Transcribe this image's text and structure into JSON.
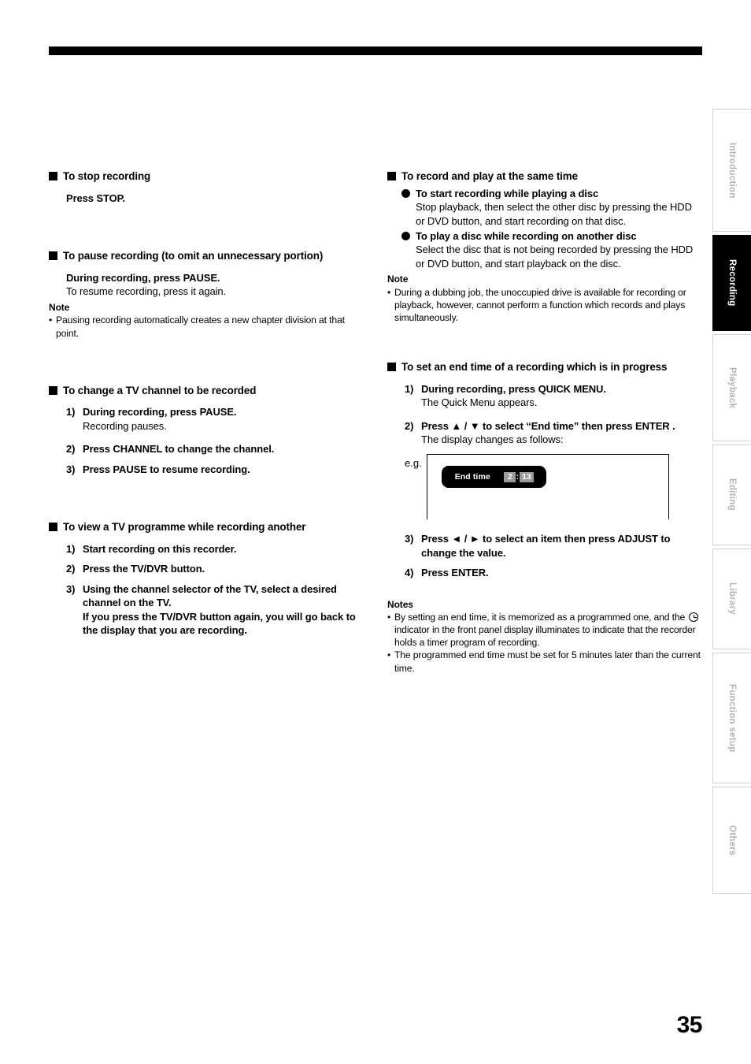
{
  "page": {
    "number": "35",
    "top_rule": true
  },
  "tabs": [
    {
      "label": "Introduction",
      "active": false
    },
    {
      "label": "Recording",
      "active": true
    },
    {
      "label": "Playback",
      "active": false
    },
    {
      "label": "Editing",
      "active": false
    },
    {
      "label": "Library",
      "active": false
    },
    {
      "label": "Function setup",
      "active": false
    },
    {
      "label": "Others",
      "active": false
    }
  ],
  "left_column": {
    "section_stop": {
      "heading": "To stop recording",
      "instruction": "Press STOP."
    },
    "section_pause": {
      "heading": "To pause recording (to omit an unnecessary portion)",
      "instruction": "During recording, press PAUSE.",
      "detail": "To resume recording, press it again.",
      "note_title": "Note",
      "note_items": [
        "Pausing recording automatically creates a new chapter division at that point."
      ]
    },
    "section_change_channel": {
      "heading": "To change a TV channel to be recorded",
      "steps": [
        {
          "num": "1)",
          "text": "During recording, press PAUSE.",
          "sub": "Recording pauses."
        },
        {
          "num": "2)",
          "text": "Press CHANNEL to change the channel.",
          "sub": ""
        },
        {
          "num": "3)",
          "text": "Press PAUSE to resume recording.",
          "sub": ""
        }
      ]
    },
    "section_view_tv": {
      "heading": "To view a TV programme while recording another",
      "steps": [
        {
          "num": "1)",
          "text": "Start recording on this recorder.",
          "sub": ""
        },
        {
          "num": "2)",
          "text": "Press the TV/DVR button.",
          "sub": ""
        },
        {
          "num": "3)",
          "text": "Using the channel selector of the TV, select a desired channel on the TV.",
          "sub": ""
        }
      ],
      "step3_extra": "If you press the TV/DVR button again, you will go back to the display that you are recording."
    }
  },
  "right_column": {
    "section_record_play": {
      "heading": "To record and play at the same time",
      "subsections": [
        {
          "heading": "To start recording while playing a disc",
          "body": "Stop playback, then select the other disc by pressing the HDD or DVD button, and start recording on that disc."
        },
        {
          "heading": "To play a disc while recording on another disc",
          "body": "Select the disc that is not being recorded by pressing the HDD or DVD button, and start playback on the disc."
        }
      ],
      "note_title": "Note",
      "note_items": [
        "During a dubbing job, the unoccupied drive is available for recording or playback, however, cannot perform a function which records and plays simultaneously."
      ]
    },
    "section_end_time": {
      "heading": "To set an end time of a recording which is in progress",
      "steps": [
        {
          "num": "1)",
          "text": "During recording, press QUICK MENU.",
          "sub": "The Quick Menu appears."
        },
        {
          "num": "2)",
          "text": "Press ▲ / ▼ to select “End time” then press ENTER .",
          "sub": "The display changes as follows:"
        }
      ],
      "example": {
        "label": "e.g.",
        "osd_label": "End time",
        "osd_hours": "2",
        "osd_separator": ":",
        "osd_minutes": "13"
      },
      "steps_after": [
        {
          "num": "3)",
          "text": "Press ◄ / ► to select an item then press ADJUST to change the value.",
          "sub": ""
        },
        {
          "num": "4)",
          "text": "Press ENTER.",
          "sub": ""
        }
      ],
      "note_title": "Notes",
      "note_items_pre_icon": "By setting an end time, it is memorized as a programmed one, and the ",
      "note_items_post_icon": " indicator in the front panel display illuminates to indicate that the recorder holds a timer program of recording.",
      "note_item_2": "The programmed end time must be set for 5 minutes later than the current time."
    }
  },
  "colors": {
    "text": "#000000",
    "tab_inactive_text": "#b4b4b4",
    "tab_border": "#d2d2d2",
    "tab_active_bg": "#000000",
    "osd_bg": "#000000",
    "osd_highlight": "#999999"
  }
}
